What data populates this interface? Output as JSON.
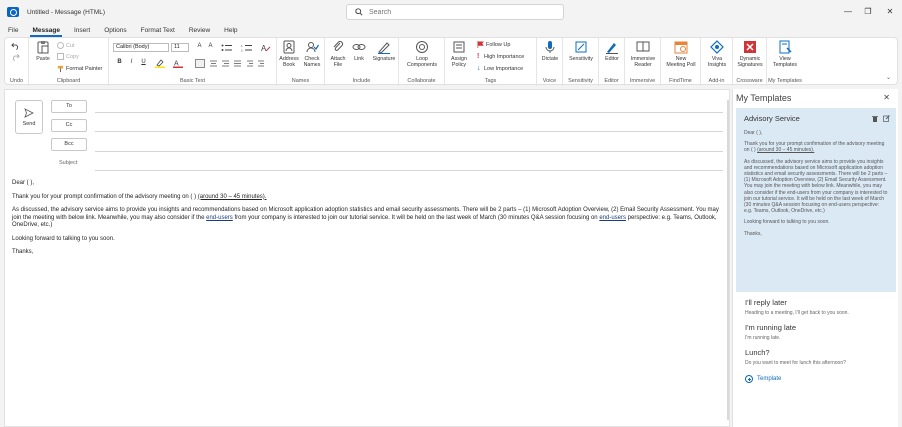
{
  "window": {
    "title": "Untitled  -  Message (HTML)",
    "search_placeholder": "Search",
    "controls": [
      "—",
      "❐",
      "✕"
    ]
  },
  "menu": {
    "tabs": [
      "File",
      "Message",
      "Insert",
      "Options",
      "Format Text",
      "Review",
      "Help"
    ],
    "active": "Message"
  },
  "ribbon": {
    "undo": {
      "label": "Undo"
    },
    "clipboard": {
      "label": "Clipboard",
      "paste": "Paste",
      "cut": "Cut",
      "copy": "Copy",
      "format_painter": "Format Painter"
    },
    "basic_text": {
      "label": "Basic Text",
      "font": "Calibri (Body)",
      "size": "11"
    },
    "names": {
      "label": "Names",
      "address_book": "Address\nBook",
      "check_names": "Check\nNames"
    },
    "include": {
      "label": "Include",
      "attach_file": "Attach\nFile",
      "link": "Link",
      "signature": "Signature"
    },
    "collaborate": {
      "label": "Collaborate",
      "loop": "Loop\nComponents"
    },
    "tags": {
      "label": "Tags",
      "assign_policy": "Assign\nPolicy",
      "follow_up": "Follow Up",
      "high": "High Importance",
      "low": "Low Importance"
    },
    "voice": {
      "label": "Voice",
      "dictate": "Dictate"
    },
    "sensitivity": {
      "label": "Sensitivity",
      "btn": "Sensitivity"
    },
    "editor": {
      "label": "Editor",
      "btn": "Editor"
    },
    "immersive": {
      "label": "Immersive",
      "btn": "Immersive\nReader"
    },
    "findtime": {
      "label": "FindTime",
      "btn": "New\nMeeting Poll"
    },
    "addin": {
      "label": "Add-in",
      "btn": "Viva\nInsights"
    },
    "crossware": {
      "label": "Crossware",
      "btn": "Dynamic\nSignatures"
    },
    "mytemplates": {
      "label": "My Templates",
      "btn": "View\nTemplates"
    }
  },
  "compose": {
    "send": "Send",
    "to": "To",
    "cc": "Cc",
    "bcc": "Bcc",
    "subject": "Subject",
    "body": {
      "greeting": "Dear (                    ),",
      "p1_a": "Thank you for your prompt confirmation of the advisory meeting on (                         ) ",
      "p1_u": "(around 30 – 45 minutes).",
      "p2_a": "As discussed, the advisory service aims to provide you insights and recommendations based on Microsoft application adoption statistics and email security assessments. There will be 2 parts – (1) Microsoft Adoption Overview, (2) Email Security Assessment. You may join the meeting with below link. Meanwhile, you may also consider if the ",
      "p2_link1": "end-users",
      "p2_b": " from your company is interested to join our tutorial service. It will be held on the last week of March (30 minutes Q&A session focusing on ",
      "p2_link2": "end-users",
      "p2_c": " perspective: e.g. Teams, Outlook, OneDrive, etc.)",
      "p3": "Looking forward to talking to you soon.",
      "p4": "Thanks,"
    }
  },
  "templates_pane": {
    "title": "My Templates",
    "selected": {
      "title": "Advisory Service",
      "body_greeting": "Dear (                    ),",
      "body_p1": "Thank you for your prompt confirmation of the advisory meeting on (                         ) ",
      "body_p1_u": "(around 30 – 45 minutes).",
      "body_p2": "As discussed, the advisory service aims to provide you insights and recommendations based on Microsoft application adoption statistics and email security assessments. There will be 2 parts – (1) Microsoft Adoption Overview, (2) Email Security Assessment. You may join the meeting with below link. Meanwhile, you may also consider if the end-users from your company is interested to join our tutorial service. It will be held on the last week of March (30 minutes Q&A session focusing on end-users perspective: e.g. Teams, Outlook, OneDrive, etc.)",
      "body_p3": "Looking forward to talking to you soon.",
      "body_p4": "Thanks,"
    },
    "items": [
      {
        "title": "I'll reply later",
        "desc": "Heading to a meeting, I'll get back to you soon."
      },
      {
        "title": "I'm running late",
        "desc": "I'm running late."
      },
      {
        "title": "Lunch?",
        "desc": "Do you want to meet for lunch this afternoon?"
      }
    ],
    "add_label": "Template"
  },
  "colors": {
    "accent": "#0f6cbd",
    "selected_card": "#dbe9f5"
  }
}
